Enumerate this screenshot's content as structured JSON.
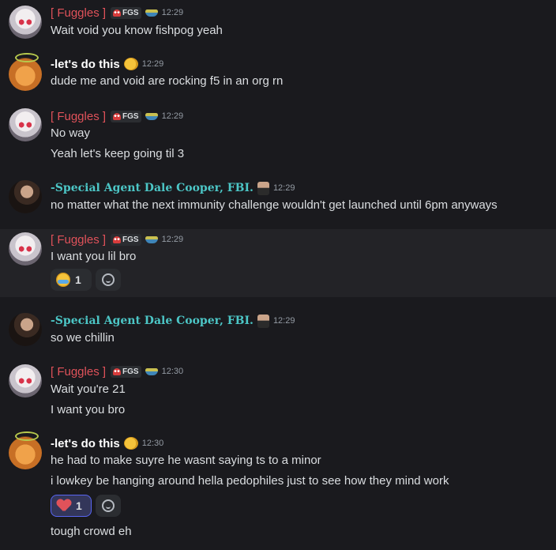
{
  "messages": [
    {
      "author": "[ Fuggles ]",
      "tag": "FGS",
      "time": "12:29",
      "lines": [
        "Wait void you know fishpog yeah"
      ]
    },
    {
      "author": "-let's do this",
      "time": "12:29",
      "lines": [
        "dude me and void are rocking f5 in an org rn"
      ]
    },
    {
      "author": "[ Fuggles ]",
      "tag": "FGS",
      "time": "12:29",
      "lines": [
        "No way",
        "Yeah let's keep going til 3"
      ]
    },
    {
      "author": "-Special Agent Dale Cooper, FBI.",
      "time": "12:29",
      "lines": [
        "no matter what the next immunity challenge wouldn't get launched until 6pm anyways"
      ]
    },
    {
      "author": "[ Fuggles ]",
      "tag": "FGS",
      "time": "12:29",
      "lines": [
        "I want you lil bro"
      ],
      "reaction": {
        "emoji": "sob",
        "count": "1"
      }
    },
    {
      "author": "-Special Agent Dale Cooper, FBI.",
      "time": "12:29",
      "lines": [
        "so we chillin"
      ]
    },
    {
      "author": "[ Fuggles ]",
      "tag": "FGS",
      "time": "12:30",
      "lines": [
        "Wait you're 21",
        "I want you bro"
      ]
    },
    {
      "author": "-let's do this",
      "time": "12:30",
      "lines": [
        "he had to make suyre he wasnt saying ts to a minor",
        "i lowkey be hanging around hella pedophiles just to see how they mind work"
      ],
      "reaction": {
        "emoji": "heart-bandage",
        "count": "1"
      },
      "after_reaction": "tough crowd eh"
    }
  ],
  "colors": {
    "fuggles": "#e0525a",
    "dale": "#4cc6c6",
    "background": "#1a1a1e"
  }
}
